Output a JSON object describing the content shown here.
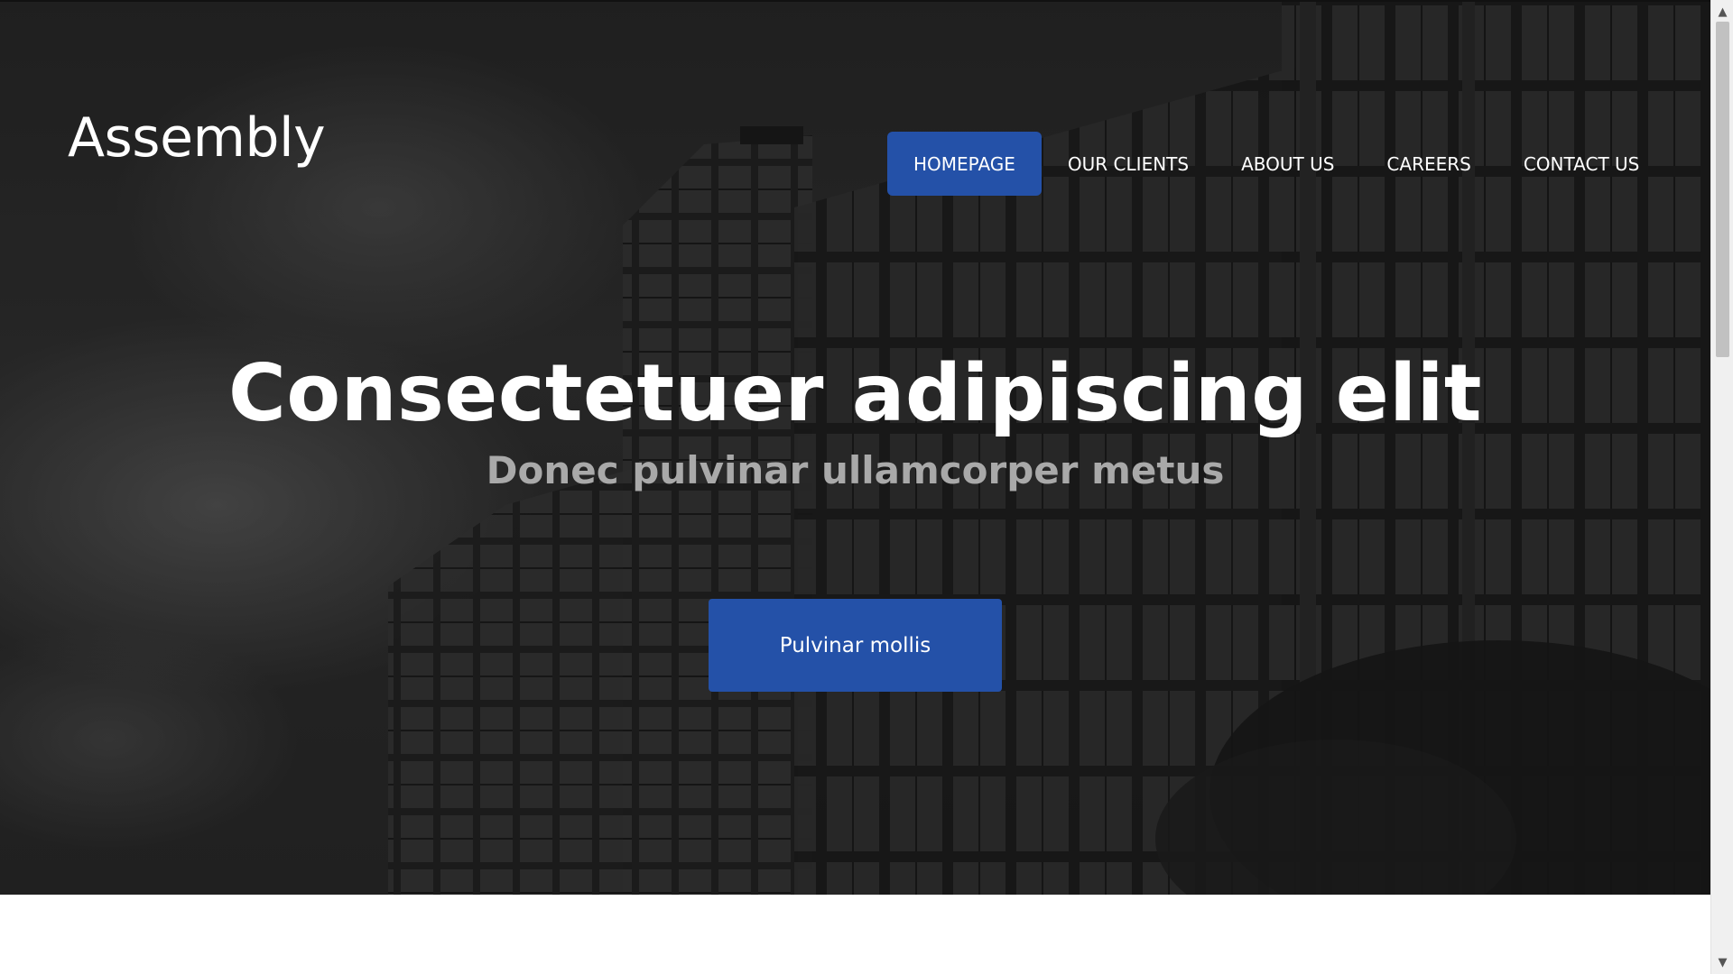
{
  "brand": {
    "logo_text": "Assembly"
  },
  "nav": {
    "items": [
      {
        "label": "HOMEPAGE",
        "active": true
      },
      {
        "label": "OUR CLIENTS",
        "active": false
      },
      {
        "label": "ABOUT US",
        "active": false
      },
      {
        "label": "CAREERS",
        "active": false
      },
      {
        "label": "CONTACT US",
        "active": false
      }
    ]
  },
  "hero": {
    "headline": "Consectetuer adipiscing elit",
    "subheadline": "Donec pulvinar ullamcorper metus",
    "cta_label": "Pulvinar mollis",
    "background": "dark grayscale photo of glass office building",
    "accent_color": "#2451a8"
  },
  "scrollbar": {
    "up_icon": "chevron-up-icon",
    "down_icon": "chevron-down-icon"
  }
}
